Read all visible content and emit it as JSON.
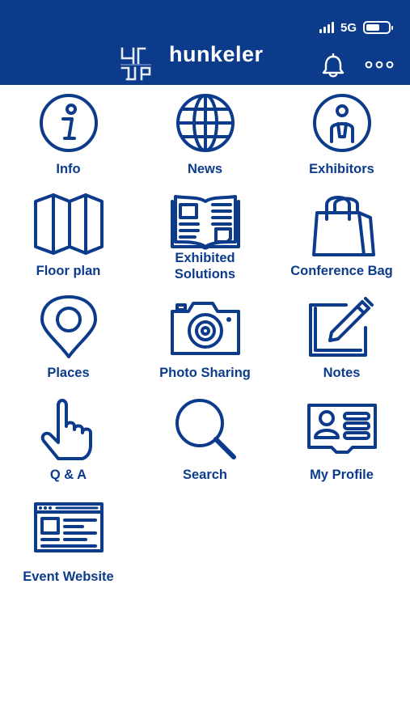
{
  "status_bar": {
    "network": "5G",
    "battery_level": 0.6,
    "signal_bars": 4
  },
  "header": {
    "brand": "hunkeler",
    "notification_icon": "bell-icon",
    "menu_icon": "more-dots-icon"
  },
  "tiles": [
    {
      "label": "Info",
      "icon": "info-icon"
    },
    {
      "label": "News",
      "icon": "globe-icon"
    },
    {
      "label": "Exhibitors",
      "icon": "exhibitor-icon"
    },
    {
      "label": "Floor plan",
      "icon": "map-icon"
    },
    {
      "label": "Exhibited\nSolutions",
      "icon": "catalog-icon"
    },
    {
      "label": "Conference Bag",
      "icon": "shopping-bag-icon"
    },
    {
      "label": "Places",
      "icon": "location-pin-icon"
    },
    {
      "label": "Photo Sharing",
      "icon": "camera-icon"
    },
    {
      "label": "Notes",
      "icon": "edit-note-icon"
    },
    {
      "label": "Q & A",
      "icon": "pointing-hand-icon"
    },
    {
      "label": "Search",
      "icon": "search-icon"
    },
    {
      "label": "My Profile",
      "icon": "profile-card-icon"
    },
    {
      "label": "Event Website",
      "icon": "website-icon"
    }
  ],
  "colors": {
    "brand_blue": "#0c3b8c",
    "background": "#ffffff"
  }
}
